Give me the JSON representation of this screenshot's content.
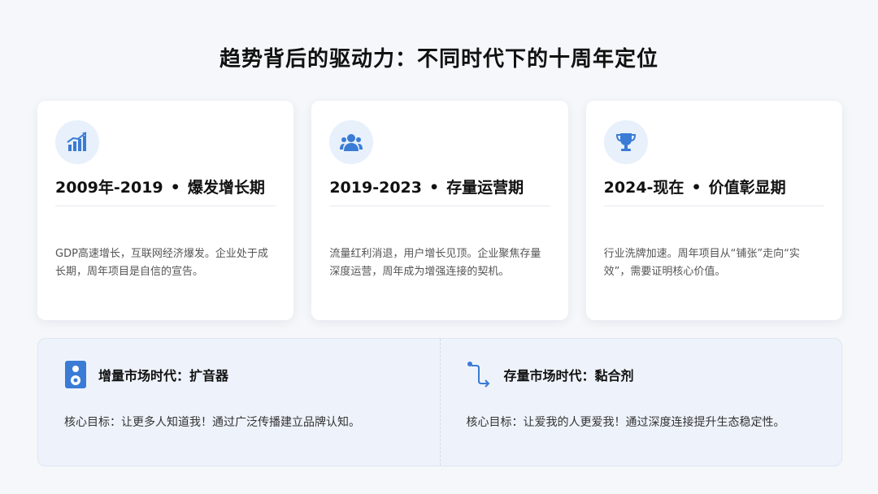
{
  "page": {
    "title": "趋势背后的驱动力：不同时代下的十周年定位"
  },
  "cards": [
    {
      "period": "2009年-2019",
      "separator": "•",
      "phase": "爆发增长期",
      "description": "GDP高速增长，互联网经济爆发。企业处于成长期，周年项目是自信的宣告。",
      "icon": "bar-chart-growth-icon"
    },
    {
      "period": "2019-2023",
      "separator": "•",
      "phase": "存量运营期",
      "description": "流量红利消退，用户增长见顶。企业聚焦存量深度运营，周年成为增强连接的契机。",
      "icon": "users-icon"
    },
    {
      "period": "2024-现在",
      "separator": "•",
      "phase": "价值彰显期",
      "description": "行业洗牌加速。周年项目从“铺张”走向“实效”，需要证明核心价值。",
      "icon": "trophy-icon"
    }
  ],
  "eras": [
    {
      "title": "增量市场时代：扩音器",
      "description": "核心目标：让更多人知道我！通过广泛传播建立品牌认知。",
      "icon": "speaker-icon"
    },
    {
      "title": "存量市场时代：黏合剂",
      "description": "核心目标：让爱我的人更爱我！通过深度连接提升生态稳定性。",
      "icon": "route-connect-icon"
    }
  ],
  "colors": {
    "accent": "#3a7bd5",
    "icon_bg": "#e7f0fb",
    "panel_bg": "#eef3fb",
    "page_bg": "#f5f7fa"
  }
}
